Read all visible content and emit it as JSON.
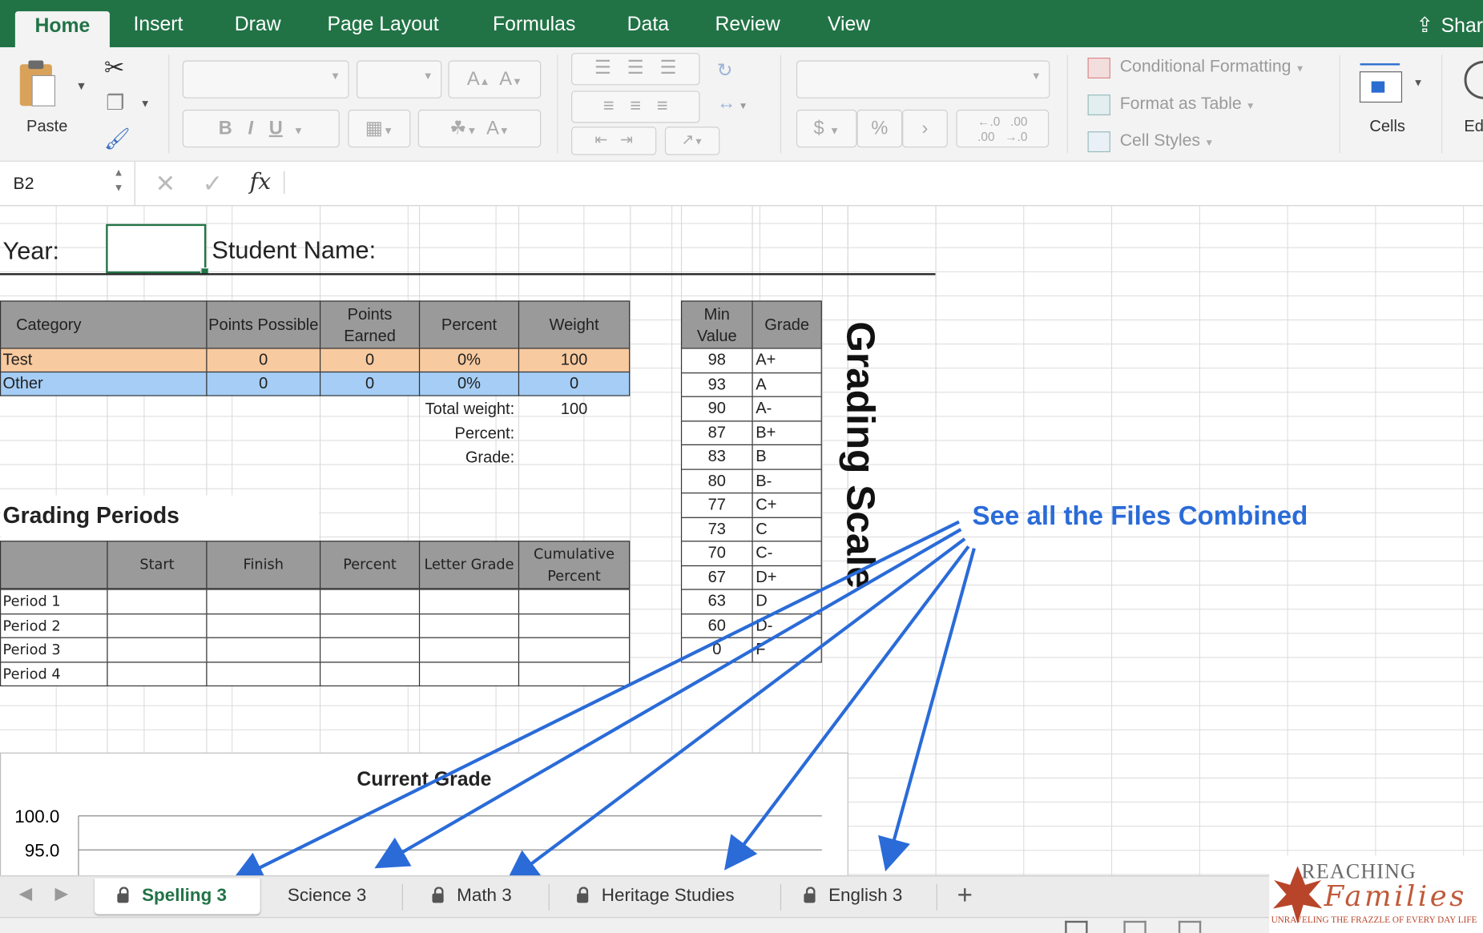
{
  "ribbon_tabs": [
    "Home",
    "Insert",
    "Draw",
    "Page Layout",
    "Formulas",
    "Data",
    "Review",
    "View"
  ],
  "share_label": "Shar",
  "clipboard": {
    "paste_label": "Paste"
  },
  "styles": {
    "conditional_formatting": "Conditional Formatting",
    "format_as_table": "Format as Table",
    "cell_styles": "Cell Styles"
  },
  "cells_label": "Cells",
  "editing_label": "Ed",
  "number_format": {
    "currency": "$",
    "percent": "%",
    "comma": "›"
  },
  "formula_bar": {
    "name_box": "B2",
    "fx": "fx",
    "formula": ""
  },
  "sheet": {
    "year_label": "Year:",
    "student_label": "Student Name:",
    "category_table": {
      "headers": [
        "Category",
        "Points Possible",
        "Points Earned",
        "Percent",
        "Weight"
      ],
      "rows": [
        {
          "category": "Test",
          "possible": "0",
          "earned": "0",
          "percent": "0%",
          "weight": "100"
        },
        {
          "category": "Other",
          "possible": "0",
          "earned": "0",
          "percent": "0%",
          "weight": "0"
        }
      ],
      "total_weight_label": "Total weight:",
      "total_weight_value": "100",
      "percent_label": "Percent:",
      "grade_label": "Grade:"
    },
    "grading_periods": {
      "title": "Grading Periods",
      "headers": [
        "",
        "Start",
        "Finish",
        "Percent",
        "Letter Grade",
        "Cumulative Percent"
      ],
      "periods": [
        "Period 1",
        "Period 2",
        "Period 3",
        "Period 4"
      ]
    },
    "grade_scale": {
      "headers": [
        "Min Value",
        "Grade"
      ],
      "rows": [
        {
          "min": "98",
          "grade": "A+"
        },
        {
          "min": "93",
          "grade": "A"
        },
        {
          "min": "90",
          "grade": "A-"
        },
        {
          "min": "87",
          "grade": "B+"
        },
        {
          "min": "83",
          "grade": "B"
        },
        {
          "min": "80",
          "grade": "B-"
        },
        {
          "min": "77",
          "grade": "C+"
        },
        {
          "min": "73",
          "grade": "C"
        },
        {
          "min": "70",
          "grade": "C-"
        },
        {
          "min": "67",
          "grade": "D+"
        },
        {
          "min": "63",
          "grade": "D"
        },
        {
          "min": "60",
          "grade": "D-"
        },
        {
          "min": "0",
          "grade": "F"
        }
      ],
      "vertical_title": "Grading Scale"
    }
  },
  "chart_data": {
    "type": "bar",
    "title": "Current Grade",
    "categories": [],
    "values": [],
    "ytick_labels": [
      "100.0",
      "95.0"
    ],
    "xlabel": "",
    "ylabel": ""
  },
  "annotation": {
    "text": "See all the Files Combined",
    "color": "#2a6bd8"
  },
  "sheet_tabs": [
    {
      "label": "Spelling 3",
      "active": true,
      "locked": true
    },
    {
      "label": "Science 3",
      "active": false,
      "locked": false
    },
    {
      "label": "Math 3",
      "active": false,
      "locked": true
    },
    {
      "label": "Heritage Studies",
      "active": false,
      "locked": true
    },
    {
      "label": "English 3",
      "active": false,
      "locked": true
    }
  ],
  "add_sheet": "+",
  "logo": {
    "line1": "REACHING",
    "line2": "Families",
    "tagline": "UNRAVELING THE FRAZZLE OF EVERY DAY LIFE"
  },
  "colors": {
    "excel_green": "#217346",
    "test_row": "#f8caa0",
    "other_row": "#a5cdf5",
    "header_gray": "#9a9a9a"
  }
}
